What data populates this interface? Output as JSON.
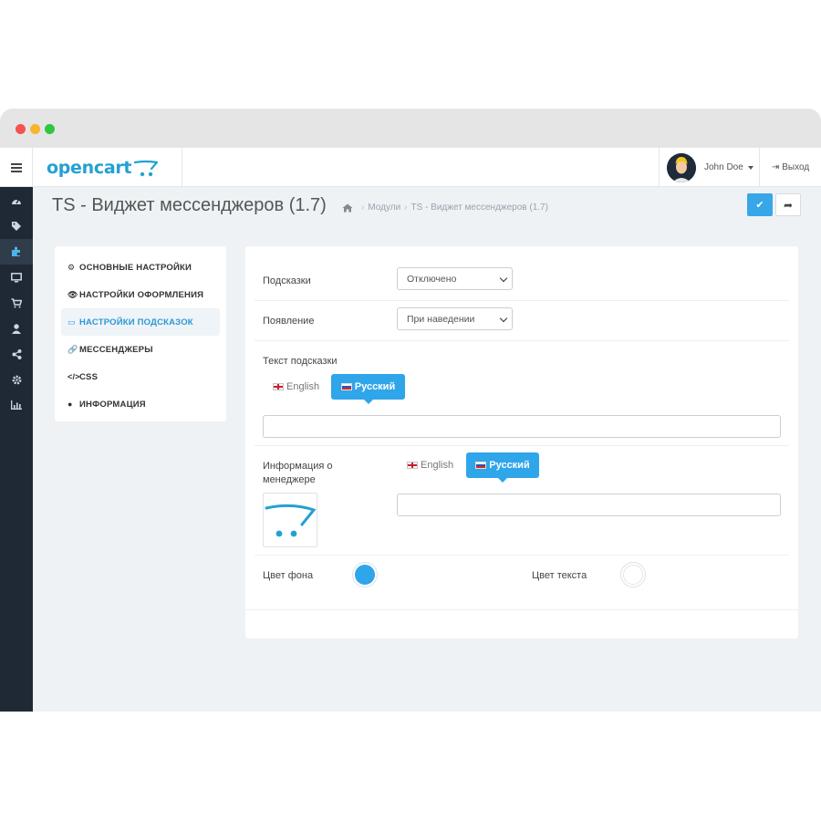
{
  "window": {
    "traffic_lights": [
      "close",
      "minimize",
      "maximize"
    ]
  },
  "header": {
    "logo_text": "opencart",
    "user_name": "John Doe",
    "logout_label": "Выход"
  },
  "sidebar": {
    "icons": [
      "dashboard-icon",
      "tag-icon",
      "puzzle-icon",
      "monitor-icon",
      "cart-icon",
      "user-icon",
      "share-icon",
      "gear-icon",
      "bar-chart-icon"
    ],
    "active_index": 2
  },
  "page": {
    "title": "TS - Виджет мессенджеров (1.7)",
    "breadcrumb": [
      "Модули",
      "TS - Виджет мессенджеров (1.7)"
    ]
  },
  "actions": {
    "save_icon": "✔",
    "back_icon": "➦"
  },
  "menu": {
    "items": [
      {
        "icon": "⚙",
        "label": "ОСНОВНЫЕ НАСТРОЙКИ"
      },
      {
        "icon": "👁",
        "label": "НАСТРОЙКИ ОФОРМЛЕНИЯ"
      },
      {
        "icon": "▭",
        "label": "НАСТРОЙКИ ПОДСКАЗОК"
      },
      {
        "icon": "🔗",
        "label": "МЕССЕНДЖЕРЫ"
      },
      {
        "icon": "</>",
        "label": "CSS"
      },
      {
        "icon": "●",
        "label": "ИНФОРМАЦИЯ"
      }
    ],
    "active_index": 2
  },
  "form": {
    "hints_label": "Подсказки",
    "hints_value": "Отключено",
    "appear_label": "Появление",
    "appear_value": "При наведении",
    "hint_text_label": "Текст подсказки",
    "lang_en": "English",
    "lang_ru": "Русский",
    "hint_text_value": "",
    "manager_info_label_1": "Информация о",
    "manager_info_label_2": "менеджере",
    "manager_info_value": "",
    "bg_color_label": "Цвет фона",
    "bg_color": "#2fa5ea",
    "text_color_label": "Цвет текста",
    "text_color": "#ffffff"
  }
}
